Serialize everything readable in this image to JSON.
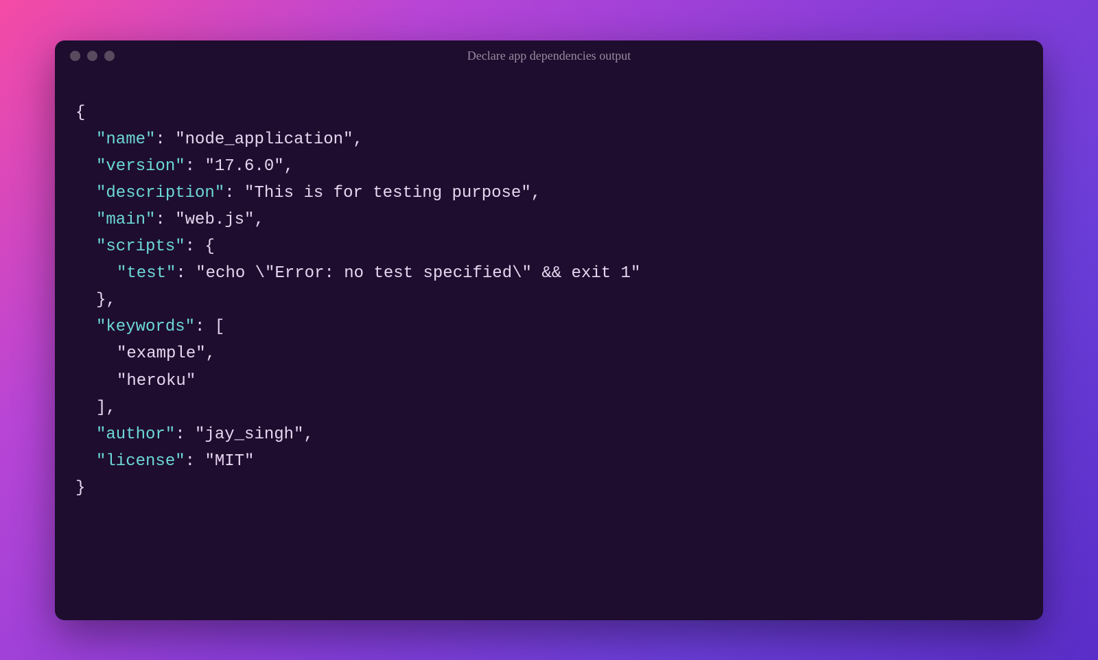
{
  "window": {
    "title": "Declare app dependencies output"
  },
  "code": {
    "brace_open": "{",
    "brace_close": "}",
    "comma": ",",
    "colon_space": ": ",
    "bracket_open": "[",
    "bracket_close": "]",
    "scripts_brace_open": "{",
    "scripts_brace_close": "}",
    "keys": {
      "name": "\"name\"",
      "version": "\"version\"",
      "description": "\"description\"",
      "main": "\"main\"",
      "scripts": "\"scripts\"",
      "test": "\"test\"",
      "keywords": "\"keywords\"",
      "author": "\"author\"",
      "license": "\"license\""
    },
    "values": {
      "name": "\"node_application\"",
      "version": "\"17.6.0\"",
      "description": "\"This is for testing purpose\"",
      "main": "\"web.js\"",
      "test": "\"echo \\\"Error: no test specified\\\" && exit 1\"",
      "author": "\"jay_singh\"",
      "license": "\"MIT\""
    },
    "keywords_items": [
      "\"example\"",
      "\"heroku\""
    ]
  }
}
